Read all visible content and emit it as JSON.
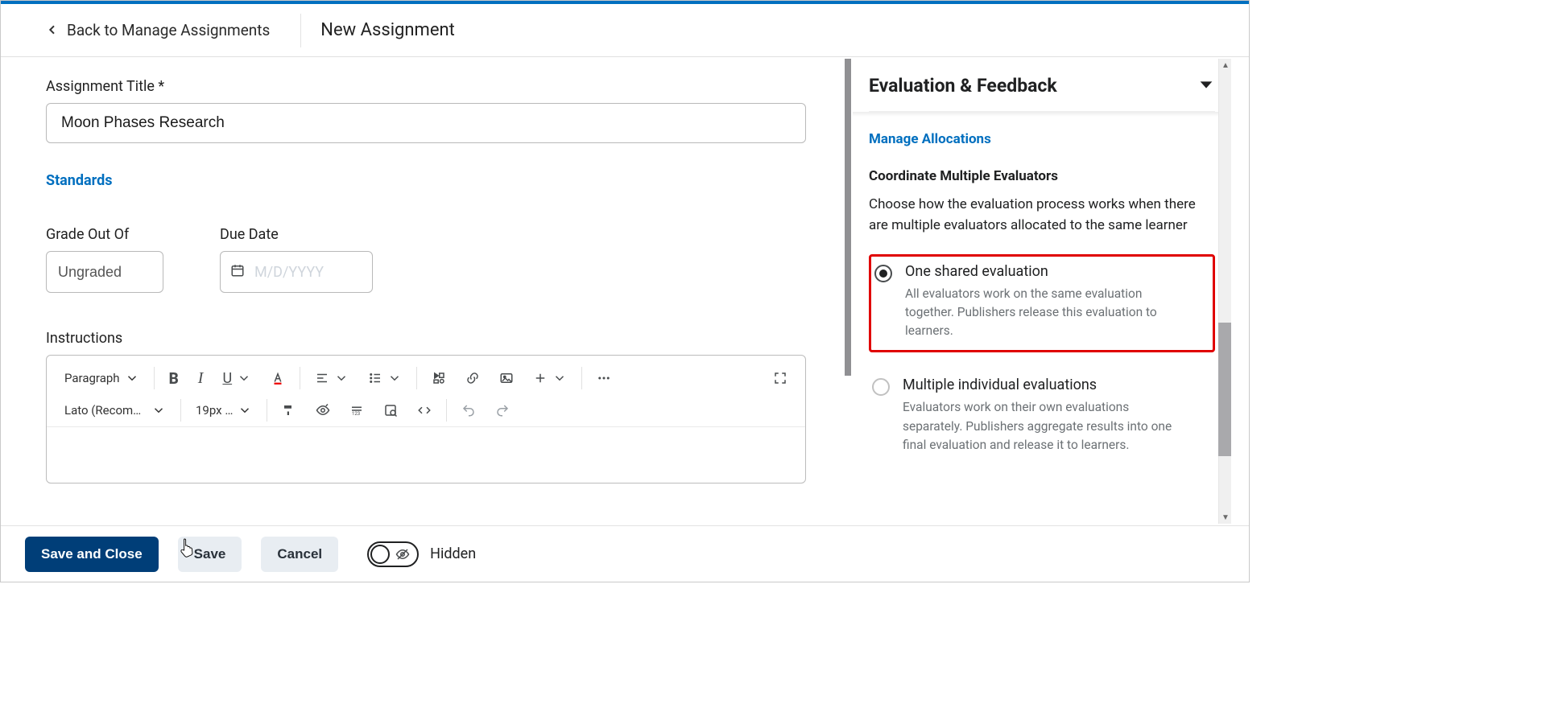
{
  "header": {
    "back_label": "Back to Manage Assignments",
    "page_title": "New Assignment"
  },
  "main": {
    "title_label": "Assignment Title *",
    "title_value": "Moon Phases Research",
    "standards_link": "Standards",
    "grade_label": "Grade Out Of",
    "grade_value": "Ungraded",
    "due_label": "Due Date",
    "due_placeholder": "M/D/YYYY",
    "instructions_label": "Instructions",
    "rte": {
      "block_format": "Paragraph",
      "font_family": "Lato (Recom…",
      "font_size": "19px …"
    }
  },
  "side": {
    "panel_title": "Evaluation & Feedback",
    "manage_link": "Manage Allocations",
    "coord_heading": "Coordinate Multiple Evaluators",
    "coord_desc": "Choose how the evaluation process works when there are multiple evaluators allocated to the same learner",
    "options": [
      {
        "title": "One shared evaluation",
        "desc": "All evaluators work on the same evaluation together. Publishers release this evaluation to learners.",
        "selected": true
      },
      {
        "title": "Multiple individual evaluations",
        "desc": "Evaluators work on their own evaluations separately. Publishers aggregate results into one final evaluation and release it to learners.",
        "selected": false
      }
    ]
  },
  "footer": {
    "save_close": "Save and Close",
    "save": "Save",
    "cancel": "Cancel",
    "visibility": "Hidden"
  }
}
